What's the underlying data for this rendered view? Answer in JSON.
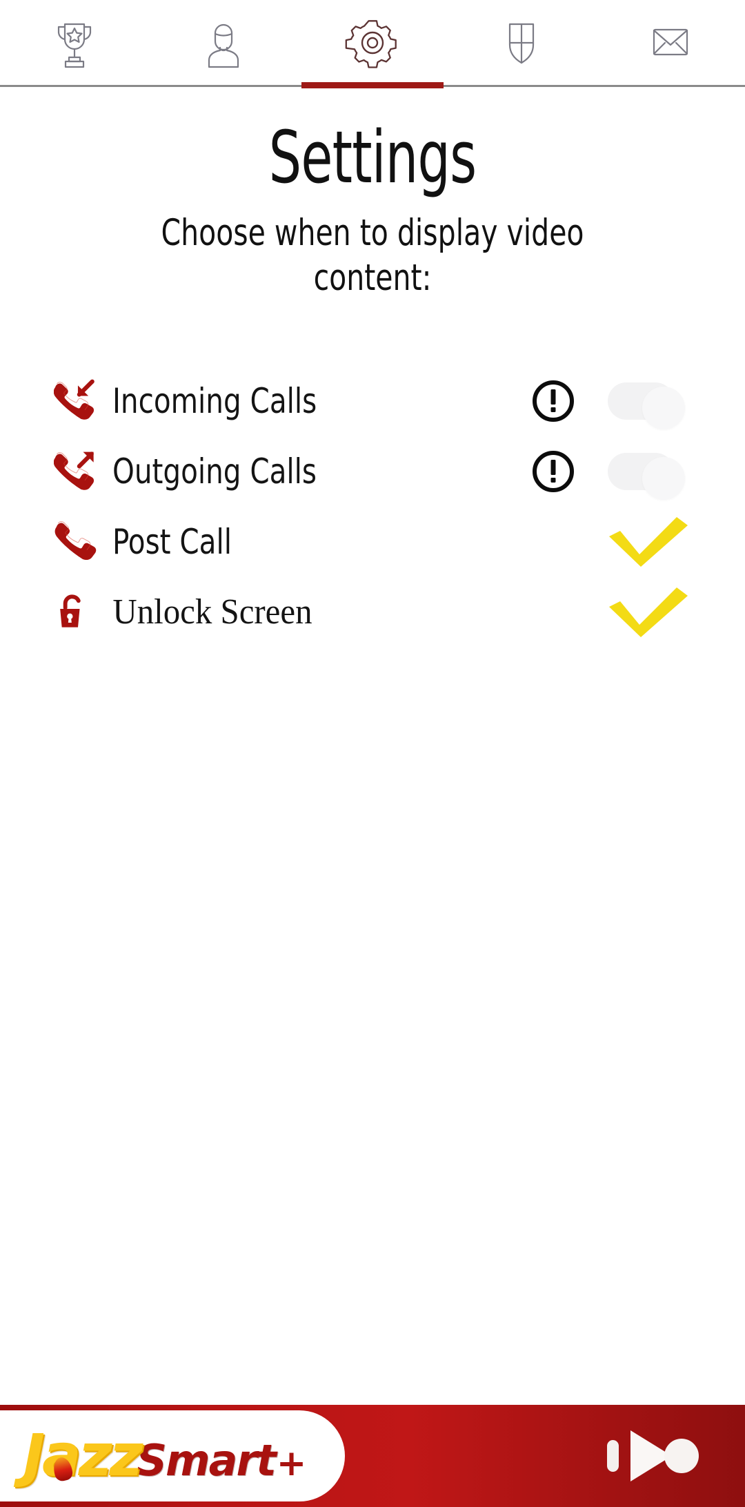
{
  "tabbar": {
    "active_index": 2,
    "active_underline_color": "#9E1A16",
    "icon_color": "#7B7B85",
    "active_icon_color": "#5C3434",
    "items": [
      {
        "name": "trophy-icon",
        "label": "Rewards"
      },
      {
        "name": "person-icon",
        "label": "Profile"
      },
      {
        "name": "gear-icon",
        "label": "Settings"
      },
      {
        "name": "shield-icon",
        "label": "Protection"
      },
      {
        "name": "envelope-icon",
        "label": "Messages"
      }
    ]
  },
  "header": {
    "title": "Settings",
    "subtitle": "Choose when to display video content:"
  },
  "settings": {
    "rows": [
      {
        "label": "Incoming Calls",
        "icon": "phone-incoming-icon",
        "status_icon": "exclamation-circle-icon",
        "control": "ghost-toggle",
        "enabled": false,
        "label_font": "sans"
      },
      {
        "label": "Outgoing Calls",
        "icon": "phone-outgoing-icon",
        "status_icon": "exclamation-circle-icon",
        "control": "ghost-toggle",
        "enabled": false,
        "label_font": "sans"
      },
      {
        "label": "Post Call",
        "icon": "phone-icon",
        "status_icon": "",
        "control": "yellow-check",
        "enabled": true,
        "label_font": "sans"
      },
      {
        "label": "Unlock Screen",
        "icon": "unlock-icon",
        "status_icon": "",
        "control": "yellow-check",
        "enabled": true,
        "label_font": "serif"
      }
    ]
  },
  "colors": {
    "phone_icon_red": "#A8120F",
    "check_yellow": "#F3DB15",
    "banner_red": "#B81414",
    "brand_yellow": "#FBC71B",
    "brand_red": "#A8120F",
    "warning_black": "#0C0C0C",
    "ghost_gray": "#F2F2F3"
  },
  "banner": {
    "brand_primary": "Jazz",
    "brand_secondary": "Smart",
    "brand_suffix": "+",
    "right_logo": "play-media-icon"
  }
}
